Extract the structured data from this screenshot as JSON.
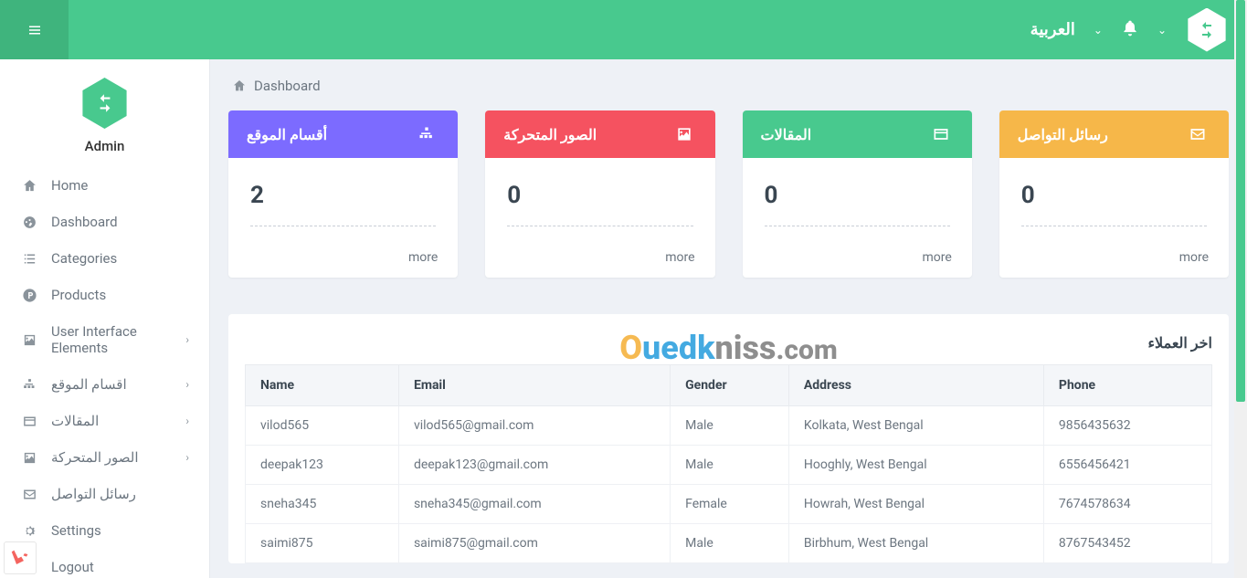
{
  "topbar": {
    "language": "العربية"
  },
  "sidebar": {
    "title": "Admin",
    "items": [
      {
        "label": "Home",
        "icon": "home",
        "expandable": false
      },
      {
        "label": "Dashboard",
        "icon": "dashboard",
        "expandable": false
      },
      {
        "label": "Categories",
        "icon": "list",
        "expandable": false
      },
      {
        "label": "Products",
        "icon": "circle-p",
        "expandable": false
      },
      {
        "label": "User Interface Elements",
        "icon": "image",
        "expandable": true
      },
      {
        "label": "اقسام الموقع",
        "icon": "sitemap",
        "expandable": true
      },
      {
        "label": "المقالات",
        "icon": "card",
        "expandable": true
      },
      {
        "label": "الصور المتحركة",
        "icon": "image",
        "expandable": true
      },
      {
        "label": "رسائل التواصل",
        "icon": "envelope",
        "expandable": false
      },
      {
        "label": "Settings",
        "icon": "gears",
        "expandable": false
      },
      {
        "label": "Logout",
        "icon": "logout",
        "expandable": false
      }
    ]
  },
  "breadcrumb": {
    "label": "Dashboard"
  },
  "cards": [
    {
      "title": "أقسام الموقع",
      "value": "2",
      "more": "more",
      "color": "bg-purple",
      "icon": "sitemap"
    },
    {
      "title": "الصور المتحركة",
      "value": "0",
      "more": "more",
      "color": "bg-red",
      "icon": "image"
    },
    {
      "title": "المقالات",
      "value": "0",
      "more": "more",
      "color": "bg-green",
      "icon": "card"
    },
    {
      "title": "رسائل التواصل",
      "value": "0",
      "more": "more",
      "color": "bg-orange",
      "icon": "envelope"
    }
  ],
  "table": {
    "title": "اخر العملاء",
    "columns": [
      "Name",
      "Email",
      "Gender",
      "Address",
      "Phone"
    ],
    "rows": [
      [
        "vilod565",
        "vilod565@gmail.com",
        "Male",
        "Kolkata, West Bengal",
        "9856435632"
      ],
      [
        "deepak123",
        "deepak123@gmail.com",
        "Male",
        "Hooghly, West Bengal",
        "6556456421"
      ],
      [
        "sneha345",
        "sneha345@gmail.com",
        "Female",
        "Howrah, West Bengal",
        "7674578634"
      ],
      [
        "saimi875",
        "saimi875@gmail.com",
        "Male",
        "Birbhum, West Bengal",
        "8767543452"
      ]
    ]
  },
  "watermark": {
    "o": "O",
    "ued": "ued",
    "k": "k",
    "niss": "niss",
    "com": ".com"
  }
}
